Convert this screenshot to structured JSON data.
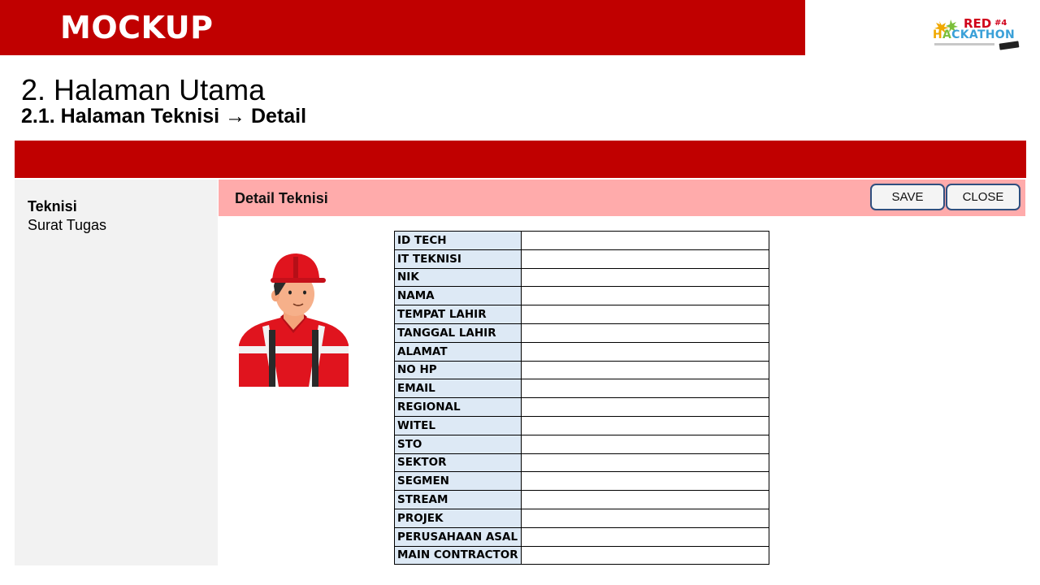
{
  "slide": {
    "banner_title": "MOCKUP",
    "heading": "2. Halaman Utama",
    "subheading": "2.1. Halaman Teknisi → Detail",
    "logo": {
      "line1": "RED",
      "badge": "#4",
      "line2_a": "H",
      "line2_b": "A",
      "line2_c": "CKATHON"
    }
  },
  "colors": {
    "brand_red": "#c00000",
    "panel_header": "#ffabab",
    "label_cell": "#dde9f5",
    "sidebar_bg": "#f2f2f2",
    "button_border": "#2f4f7f"
  },
  "sidebar": {
    "items": [
      {
        "label": "Teknisi",
        "active": true
      },
      {
        "label": "Surat Tugas",
        "active": false
      }
    ]
  },
  "panel": {
    "title": "Detail Teknisi",
    "save_label": "SAVE",
    "close_label": "CLOSE",
    "avatar_icon": "technician-avatar-icon"
  },
  "form": {
    "fields": [
      {
        "label": "ID TECH",
        "value": ""
      },
      {
        "label": "IT TEKNISI",
        "value": ""
      },
      {
        "label": "NIK",
        "value": ""
      },
      {
        "label": "NAMA",
        "value": ""
      },
      {
        "label": "TEMPAT LAHIR",
        "value": ""
      },
      {
        "label": "TANGGAL LAHIR",
        "value": ""
      },
      {
        "label": "ALAMAT",
        "value": ""
      },
      {
        "label": "NO HP",
        "value": ""
      },
      {
        "label": "EMAIL",
        "value": ""
      },
      {
        "label": "REGIONAL",
        "value": ""
      },
      {
        "label": "WITEL",
        "value": ""
      },
      {
        "label": "STO",
        "value": ""
      },
      {
        "label": "SEKTOR",
        "value": ""
      },
      {
        "label": "SEGMEN",
        "value": ""
      },
      {
        "label": "STREAM",
        "value": ""
      },
      {
        "label": "PROJEK",
        "value": ""
      },
      {
        "label": "PERUSAHAAN ASAL",
        "value": ""
      },
      {
        "label": "MAIN CONTRACTOR",
        "value": ""
      }
    ]
  }
}
